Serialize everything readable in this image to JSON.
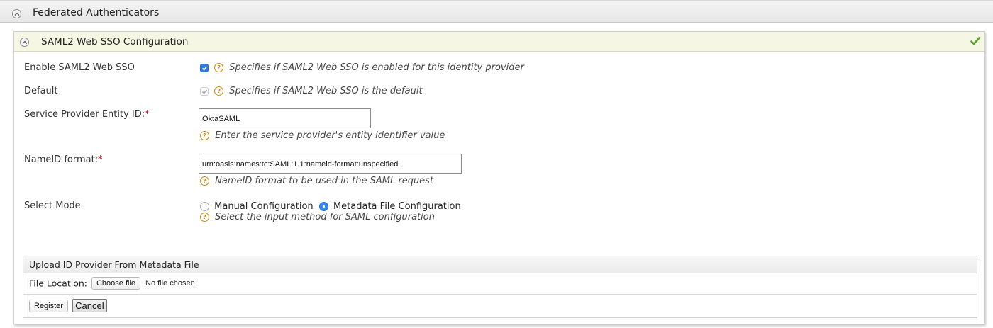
{
  "outer": {
    "title": "Federated Authenticators"
  },
  "panel": {
    "title": "SAML2 Web SSO Configuration",
    "status_icon": "checkmark-icon",
    "status_color": "#5aa02c"
  },
  "fields": {
    "enable": {
      "label": "Enable SAML2 Web SSO",
      "checked": true,
      "help": "Specifies if SAML2 Web SSO is enabled for this identity provider"
    },
    "default": {
      "label": "Default",
      "checked": true,
      "disabled": true,
      "help": "Specifies if SAML2 Web SSO is the default"
    },
    "sp_entity_id": {
      "label": "Service Provider Entity ID:",
      "required_mark": "*",
      "value": "OktaSAML",
      "help": "Enter the service provider's entity identifier value"
    },
    "nameid_format": {
      "label": "NameID format:",
      "required_mark": "*",
      "value": "urn:oasis:names:tc:SAML:1.1:nameid-format:unspecified",
      "help": "NameID format to be used in the SAML request"
    },
    "select_mode": {
      "label": "Select Mode",
      "options": [
        "Manual Configuration",
        "Metadata File Configuration"
      ],
      "selected": "Metadata File Configuration",
      "help": "Select the input method for SAML configuration"
    }
  },
  "upload": {
    "title": "Upload ID Provider From Metadata File",
    "file_label": "File Location:",
    "choose_label": "Choose file",
    "no_file_text": "No file chosen",
    "register_label": "Register",
    "cancel_label": "Cancel"
  },
  "colors": {
    "accent": "#2f7de1",
    "help_icon": "#c88a10",
    "required": "#d9001b"
  }
}
